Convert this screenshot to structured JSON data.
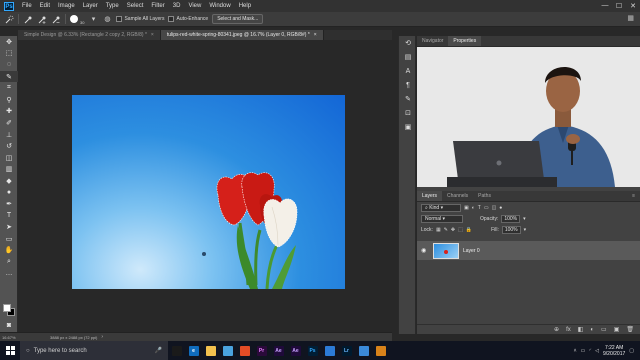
{
  "app": {
    "logo": "Ps"
  },
  "menu": [
    "File",
    "Edit",
    "Image",
    "Layer",
    "Type",
    "Select",
    "Filter",
    "3D",
    "View",
    "Window",
    "Help"
  ],
  "window_controls": [
    "—",
    "☐",
    "✕"
  ],
  "options": {
    "brush_size": "30",
    "sample_all_layers": "Sample All Layers",
    "auto_enhance": "Auto-Enhance",
    "select_mask": "Select and Mask..."
  },
  "tabs": [
    "Simple Design @ 6.33% (Rectangle 2 copy 2, RGB/8) *",
    "tulips-red-white-spring-80341.jpeg @ 16.7% (Layer 0, RGB/8#) *"
  ],
  "tab_close": "×",
  "status": {
    "zoom": "16.67%",
    "doc": "3888 px x 2488 px (72 ppi)",
    "arrow": "›"
  },
  "right_panel": {
    "top_tabs": [
      "Navigator",
      "Properties"
    ],
    "layers_tabs": [
      "Layers",
      "Channels",
      "Paths"
    ],
    "kind_label": "Kind",
    "blend_mode": "Normal",
    "opacity_label": "Opacity:",
    "opacity_value": "100%",
    "lock_label": "Lock:",
    "fill_label": "Fill:",
    "fill_value": "100%",
    "layer_name": "Layer 0",
    "footer_icons": [
      "⊕",
      "fx",
      "◧",
      "◐",
      "▭",
      "▣",
      "🗑"
    ]
  },
  "taskbar": {
    "search_placeholder": "Type here to search",
    "apps": [
      {
        "label": "",
        "color": "#1a1a1a",
        "text_color": "#ddd",
        "icon": "task-view-icon"
      },
      {
        "label": "e",
        "color": "#0f6cbd",
        "text_color": "#fff",
        "icon": "edge-icon"
      },
      {
        "label": "",
        "color": "#f2c14e",
        "text_color": "#000",
        "icon": "folder-icon"
      },
      {
        "label": "",
        "color": "#4aa3df",
        "text_color": "#fff",
        "icon": "store-icon"
      },
      {
        "label": "",
        "color": "#e34c26",
        "text_color": "#fff",
        "icon": "chrome-icon"
      },
      {
        "label": "Pr",
        "color": "#2a0a3a",
        "text_color": "#e77cff",
        "icon": "premiere-icon"
      },
      {
        "label": "Ae",
        "color": "#1f0a3a",
        "text_color": "#c7a0ff",
        "icon": "after-effects-icon"
      },
      {
        "label": "Ae",
        "color": "#1f0a3a",
        "text_color": "#c7a0ff",
        "icon": "after-effects-2-icon"
      },
      {
        "label": "Ps",
        "color": "#001e36",
        "text_color": "#31a8ff",
        "icon": "photoshop-icon"
      },
      {
        "label": "",
        "color": "#2c7bd6",
        "text_color": "#fff",
        "icon": "app-icon"
      },
      {
        "label": "Lr",
        "color": "#001a2e",
        "text_color": "#69b7ff",
        "icon": "lightroom-icon"
      },
      {
        "label": "",
        "color": "#3b8ad9",
        "text_color": "#fff",
        "icon": "app2-icon"
      },
      {
        "label": "",
        "color": "#d9831a",
        "text_color": "#fff",
        "icon": "app3-icon"
      }
    ],
    "time": "7:22 AM",
    "date": "9/20/2017"
  },
  "colors": {
    "accent": "#31a8ff",
    "selected_layer": "#5a5a5a"
  }
}
